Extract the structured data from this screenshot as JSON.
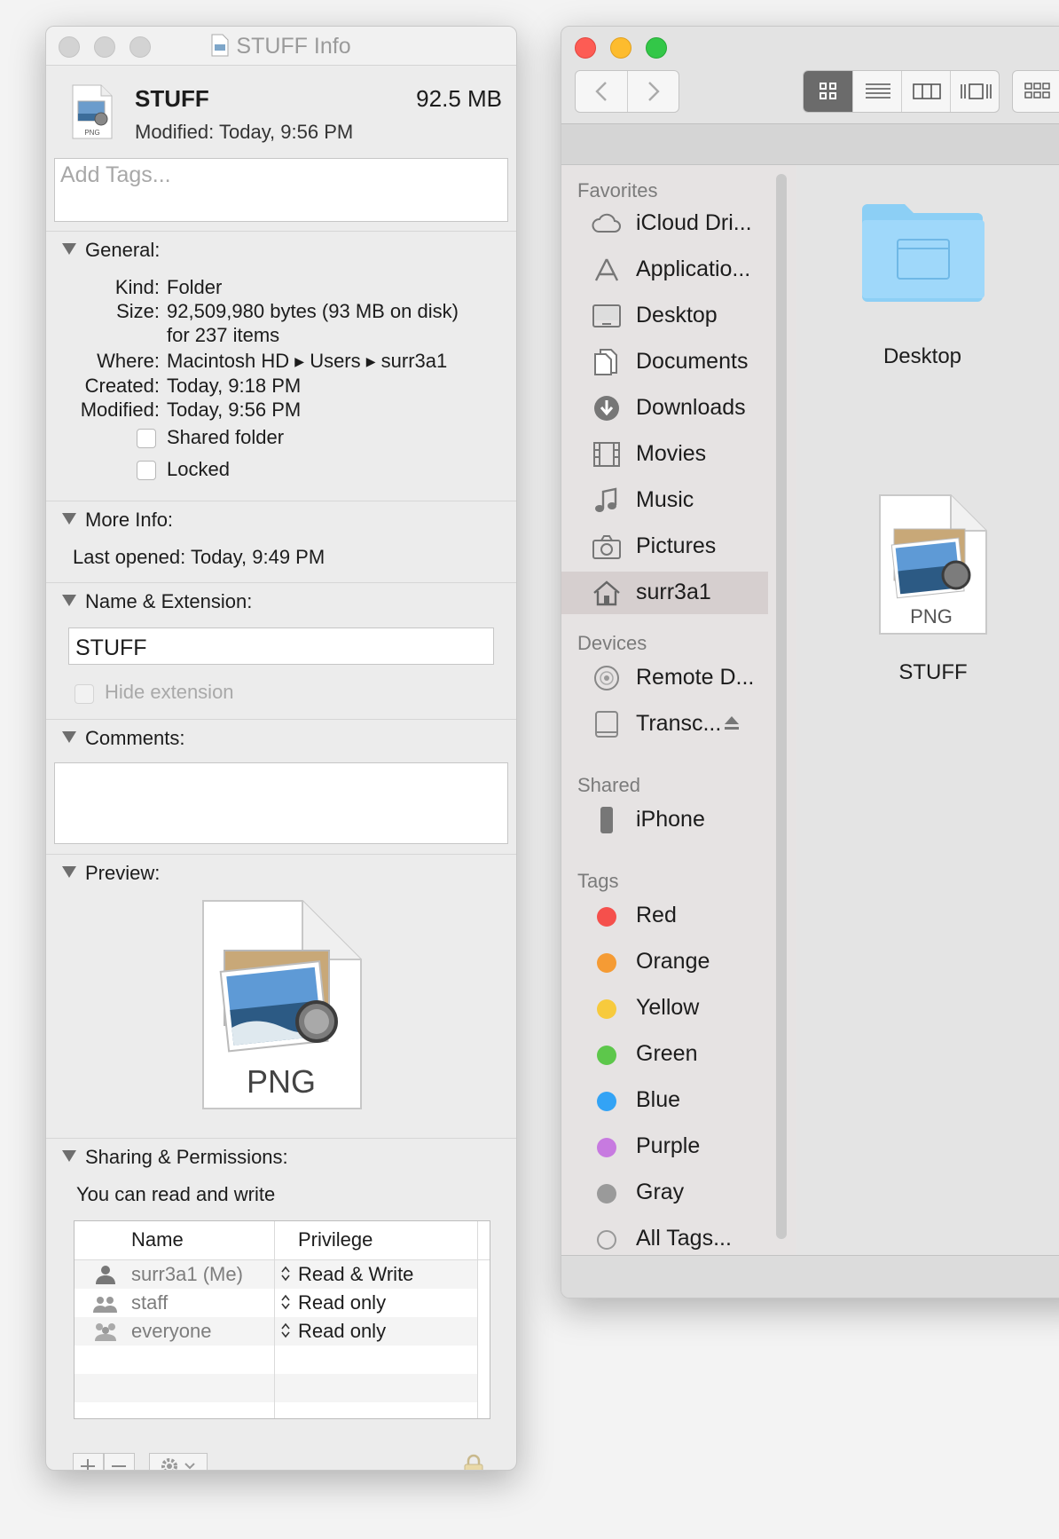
{
  "info_window": {
    "title": "STUFF Info",
    "name": "STUFF",
    "size": "92.5 MB",
    "modified_summary": "Modified:  Today, 9:56 PM",
    "icon_label": "PNG",
    "tags_placeholder": "Add Tags...",
    "general": {
      "header": "General:",
      "kind_label": "Kind:",
      "kind_value": "Folder",
      "size_label": "Size:",
      "size_value": "92,509,980 bytes (93 MB on disk)",
      "size_items": "for 237 items",
      "where_label": "Where:",
      "where_path": [
        "Macintosh HD",
        "Users",
        "surr3a1"
      ],
      "created_label": "Created:",
      "created_value": "Today, 9:18 PM",
      "modified_label": "Modified:",
      "modified_value": "Today, 9:56 PM",
      "shared_folder": "Shared folder",
      "locked": "Locked"
    },
    "more_info": {
      "header": "More Info:",
      "last_opened_label": "Last opened:",
      "last_opened_value": "Today, 9:49 PM"
    },
    "name_ext": {
      "header": "Name & Extension:",
      "name_value": "STUFF",
      "hide_extension": "Hide extension"
    },
    "comments": {
      "header": "Comments:"
    },
    "preview": {
      "header": "Preview:",
      "icon_label": "PNG"
    },
    "sharing": {
      "header": "Sharing & Permissions:",
      "summary": "You can read and write",
      "columns": [
        "Name",
        "Privilege"
      ],
      "rows": [
        {
          "name": "surr3a1 (Me)",
          "privilege": "Read & Write"
        },
        {
          "name": "staff",
          "privilege": "Read only"
        },
        {
          "name": "everyone",
          "privilege": "Read only"
        }
      ]
    }
  },
  "finder": {
    "sidebar": {
      "favorites_header": "Favorites",
      "favorites": [
        {
          "label": "iCloud Dri...",
          "icon": "cloud-icon"
        },
        {
          "label": "Applicatio...",
          "icon": "applications-icon"
        },
        {
          "label": "Desktop",
          "icon": "desktop-icon"
        },
        {
          "label": "Documents",
          "icon": "documents-icon"
        },
        {
          "label": "Downloads",
          "icon": "downloads-icon"
        },
        {
          "label": "Movies",
          "icon": "movies-icon"
        },
        {
          "label": "Music",
          "icon": "music-icon"
        },
        {
          "label": "Pictures",
          "icon": "camera-icon"
        },
        {
          "label": "surr3a1",
          "icon": "home-icon",
          "selected": true
        }
      ],
      "devices_header": "Devices",
      "devices": [
        {
          "label": "Remote D...",
          "icon": "disc-icon"
        },
        {
          "label": "Transc...",
          "icon": "drive-icon"
        }
      ],
      "shared_header": "Shared",
      "shared": [
        {
          "label": "iPhone",
          "icon": "iphone-icon"
        }
      ],
      "tags_header": "Tags",
      "tags": [
        {
          "label": "Red",
          "color": "#f5504c"
        },
        {
          "label": "Orange",
          "color": "#f59b34"
        },
        {
          "label": "Yellow",
          "color": "#f7ca3d"
        },
        {
          "label": "Green",
          "color": "#5dc74b"
        },
        {
          "label": "Blue",
          "color": "#33a3f5"
        },
        {
          "label": "Purple",
          "color": "#c77ae0"
        },
        {
          "label": "Gray",
          "color": "#9a9a9a"
        },
        {
          "label": "All Tags..."
        }
      ]
    },
    "content": {
      "items": [
        {
          "label": "Desktop",
          "type": "folder"
        },
        {
          "label": "STUFF",
          "type": "png",
          "icon_label": "PNG"
        }
      ]
    }
  }
}
